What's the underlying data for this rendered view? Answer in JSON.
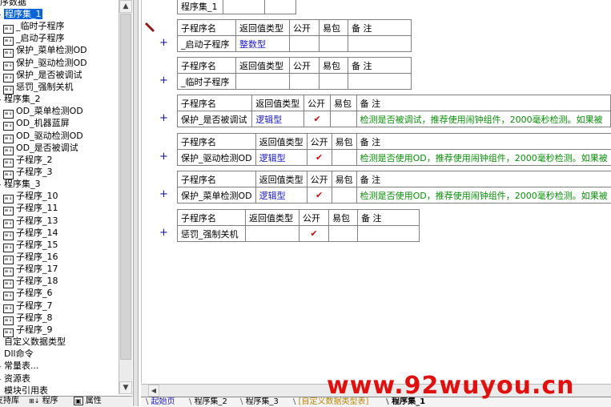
{
  "tree": {
    "header": "序数据",
    "nodes": [
      {
        "label": "程序集_1",
        "level": 0,
        "kind": "folder",
        "selected": true
      },
      {
        "label": "_临时子程序",
        "level": 1,
        "kind": "sub"
      },
      {
        "label": "_启动子程序",
        "level": 1,
        "kind": "sub"
      },
      {
        "label": "保护_菜单检测OD",
        "level": 1,
        "kind": "sub"
      },
      {
        "label": "保护_驱动检测OD",
        "level": 1,
        "kind": "sub"
      },
      {
        "label": "保护_是否被调试",
        "level": 1,
        "kind": "sub"
      },
      {
        "label": "惩罚_强制关机",
        "level": 1,
        "kind": "sub"
      },
      {
        "label": "程序集_2",
        "level": 0,
        "kind": "folder"
      },
      {
        "label": "OD_菜单检测OD",
        "level": 1,
        "kind": "sub"
      },
      {
        "label": "OD_机器蓝屏",
        "level": 1,
        "kind": "sub"
      },
      {
        "label": "OD_驱动检测OD",
        "level": 1,
        "kind": "sub"
      },
      {
        "label": "OD_是否被调试",
        "level": 1,
        "kind": "sub"
      },
      {
        "label": "子程序_2",
        "level": 1,
        "kind": "sub"
      },
      {
        "label": "子程序_3",
        "level": 1,
        "kind": "sub"
      },
      {
        "label": "程序集_3",
        "level": 0,
        "kind": "folder"
      },
      {
        "label": "子程序_10",
        "level": 1,
        "kind": "sub"
      },
      {
        "label": "子程序_11",
        "level": 1,
        "kind": "sub"
      },
      {
        "label": "子程序_13",
        "level": 1,
        "kind": "sub"
      },
      {
        "label": "子程序_14",
        "level": 1,
        "kind": "sub"
      },
      {
        "label": "子程序_15",
        "level": 1,
        "kind": "sub"
      },
      {
        "label": "子程序_16",
        "level": 1,
        "kind": "sub"
      },
      {
        "label": "子程序_17",
        "level": 1,
        "kind": "sub"
      },
      {
        "label": "子程序_18",
        "level": 1,
        "kind": "sub"
      },
      {
        "label": "子程序_6",
        "level": 1,
        "kind": "sub"
      },
      {
        "label": "子程序_7",
        "level": 1,
        "kind": "sub"
      },
      {
        "label": "子程序_8",
        "level": 1,
        "kind": "sub"
      },
      {
        "label": "子程序_9",
        "level": 1,
        "kind": "sub"
      },
      {
        "label": "自定义数据类型",
        "level": 0,
        "kind": "plain"
      },
      {
        "label": "Dll命令",
        "level": 0,
        "kind": "plain"
      },
      {
        "label": "常量表...",
        "level": 0,
        "kind": "folder"
      },
      {
        "label": "资源表",
        "level": 0,
        "kind": "folder"
      },
      {
        "label": "模块引用表",
        "level": 0,
        "kind": "plain"
      }
    ],
    "sub_icon_glyph": "≡↓"
  },
  "left_tabs": [
    {
      "label": "支持库"
    },
    {
      "label": "程序"
    },
    {
      "label": "属性"
    }
  ],
  "editor": {
    "top_partial": {
      "name": "程序集_1"
    },
    "headers": {
      "name": "子程序名",
      "ret": "返回值类型",
      "public": "公开",
      "easy": "易包",
      "note": "备 注"
    },
    "subs": [
      {
        "name": "_启动子程序",
        "ret": "整数型",
        "public": false,
        "note": ""
      },
      {
        "name": "_临时子程序",
        "ret": "",
        "public": false,
        "note": ""
      },
      {
        "name": "保护_是否被调试",
        "ret": "逻辑型",
        "public": true,
        "note": "检测是否被调试，推荐使用闹钟组件，2000毫秒检测。如果被"
      },
      {
        "name": "保护_驱动检测OD",
        "ret": "逻辑型",
        "public": true,
        "note": "检测是否使用OD，推荐使用闹钟组件，2000毫秒检测。如果被"
      },
      {
        "name": "保护_菜单检测OD",
        "ret": "逻辑型",
        "public": true,
        "note": "检测是否使用OD，推荐使用闹钟组件，2000毫秒检测。如果被"
      },
      {
        "name": "惩罚_强制关机",
        "ret": "",
        "public": true,
        "note": ""
      }
    ],
    "check_glyph": "✔",
    "plus_glyph": "+"
  },
  "doc_tabs": [
    {
      "label": "起始页"
    },
    {
      "label": "程序集_2"
    },
    {
      "label": "程序集_3"
    },
    {
      "label": "[自定义数据类型表]"
    },
    {
      "label": "程序集_1",
      "active": true
    }
  ],
  "watermark": "www.92wuyou.cn",
  "colors": {
    "selection": "#0a64d8",
    "type_text": "#1b1bc2",
    "note_text": "#0a8f0a",
    "check": "#c81010",
    "watermark": "#e0100e"
  }
}
